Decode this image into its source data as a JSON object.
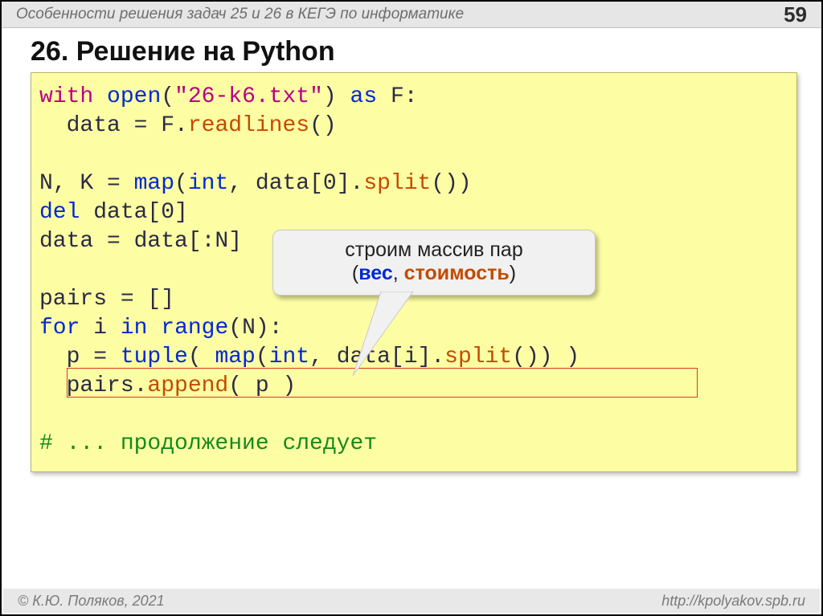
{
  "header": {
    "title": "Особенности решения задач 25 и 26 в КЕГЭ по информатике",
    "page": "59"
  },
  "heading": "26. Решение на Python",
  "code": {
    "kw_with": "with",
    "fn_open": "open",
    "paren_open": "(",
    "str_fname": "\"26-k6.txt\"",
    "paren_close": ")",
    "kw_as": "as",
    "var_f": "F:",
    "line2_pre": "  data = F.",
    "fn_readlines": "readlines",
    "empty_call": "()",
    "line4_pre": "N, K = ",
    "fn_map": "map",
    "map_arg_open": "(",
    "fn_int": "int",
    "map_mid": ", data[0].",
    "fn_split": "split",
    "split_tail": "())",
    "kw_del": "del",
    "del_rest": " data[0]",
    "line6": "data = data[:N]",
    "line8": "pairs = []",
    "kw_for": "for",
    "for_mid": " i ",
    "kw_in": "in",
    "sp": " ",
    "fn_range": "range",
    "range_tail": "(N):",
    "l10_pre": "  p = ",
    "fn_tuple": "tuple",
    "tuple_open": "( ",
    "map2_mid": ", data[i].",
    "tuple_tail": "()) )",
    "l11_pre": "  pairs.",
    "fn_append": "append",
    "append_tail": "( p )",
    "comment": "# ... продолжение следует"
  },
  "callout": {
    "line1": "строим массив пар",
    "paren_open": "(",
    "word1": "вес",
    "comma": ", ",
    "word2": "стоимость",
    "paren_close": ")"
  },
  "footer": {
    "author": "© К.Ю. Поляков, 2021",
    "url": "http://kpolyakov.spb.ru"
  }
}
